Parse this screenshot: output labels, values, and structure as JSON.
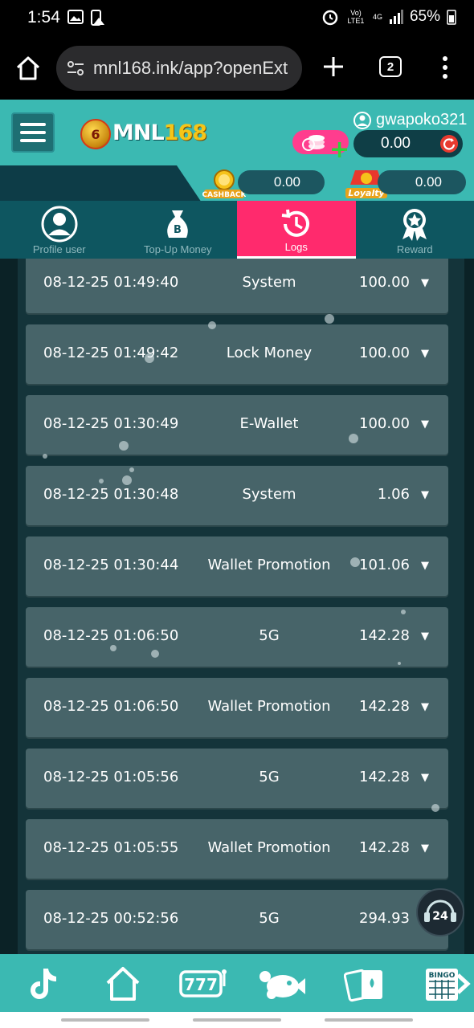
{
  "status_bar": {
    "time": "1:54",
    "network_label": "Vo) LTE1",
    "network_type": "4G",
    "battery": "65%"
  },
  "browser": {
    "url": "mnl168.ink/app?openExt",
    "tab_count": "2"
  },
  "header": {
    "logo_badge": "6",
    "logo_text_main": "MNL",
    "logo_text_num": "168",
    "username": "gwapoko321",
    "balance": "0.00",
    "cashback_label": "CASHBACK",
    "cashback_value": "0.00",
    "loyalty_label": "Loyalty",
    "loyalty_value": "0.00",
    "colors": {
      "teal": "#3bb9b2",
      "dark": "#0d3c47",
      "accent_pink": "#ff2a6d"
    }
  },
  "tabs": [
    {
      "label": "Profile user",
      "icon": "profile-icon",
      "active": false
    },
    {
      "label": "Top-Up Money",
      "icon": "money-bag-icon",
      "active": false
    },
    {
      "label": "Logs",
      "icon": "history-icon",
      "active": true
    },
    {
      "label": "Reward",
      "icon": "reward-badge-icon",
      "active": false
    }
  ],
  "logs": [
    {
      "date": "08-12-25 01:49:40",
      "type": "System",
      "amount": "100.00"
    },
    {
      "date": "08-12-25 01:49:42",
      "type": "Lock Money",
      "amount": "100.00"
    },
    {
      "date": "08-12-25 01:30:49",
      "type": "E-Wallet",
      "amount": "100.00"
    },
    {
      "date": "08-12-25 01:30:48",
      "type": "System",
      "amount": "1.06"
    },
    {
      "date": "08-12-25 01:30:44",
      "type": "Wallet Promotion",
      "amount": "101.06"
    },
    {
      "date": "08-12-25 01:06:50",
      "type": "5G",
      "amount": "142.28"
    },
    {
      "date": "08-12-25 01:06:50",
      "type": "Wallet Promotion",
      "amount": "142.28"
    },
    {
      "date": "08-12-25 01:05:56",
      "type": "5G",
      "amount": "142.28"
    },
    {
      "date": "08-12-25 01:05:55",
      "type": "Wallet Promotion",
      "amount": "142.28"
    },
    {
      "date": "08-12-25 00:52:56",
      "type": "5G",
      "amount": "294.93"
    }
  ],
  "caret": "▼",
  "chat_label": "24",
  "bottom_nav": [
    {
      "icon": "tiktok-icon"
    },
    {
      "icon": "home-icon"
    },
    {
      "icon": "slot-777-icon"
    },
    {
      "icon": "fishing-icon"
    },
    {
      "icon": "cards-icon"
    },
    {
      "icon": "bingo-icon",
      "label": "BINGO"
    }
  ]
}
